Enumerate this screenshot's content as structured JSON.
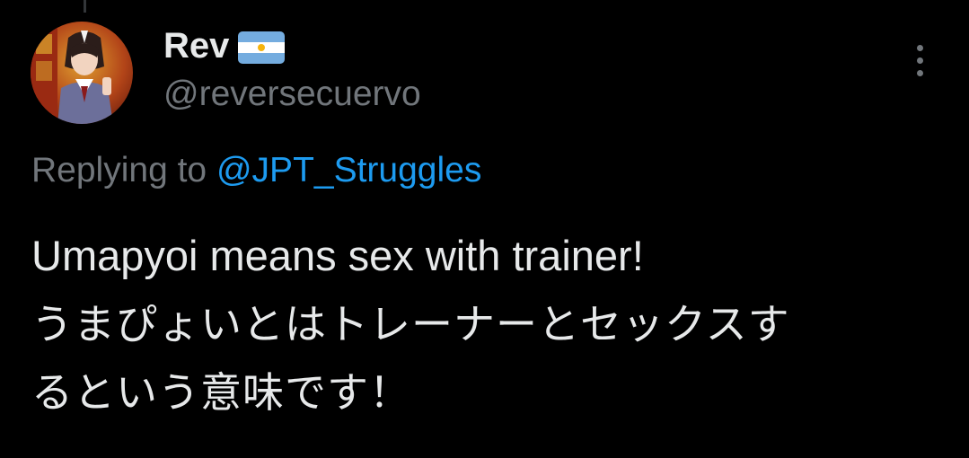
{
  "author": {
    "display_name": "Rev",
    "flag_icon": "argentina-flag-icon",
    "handle": "@reversecuervo",
    "avatar_icon": "anime-character-avatar"
  },
  "menu": {
    "more_icon": "more-vertical-icon"
  },
  "reply": {
    "prefix": "Replying to",
    "mention": "@JPT_Struggles"
  },
  "tweet": {
    "lines": [
      "Umapyoi means sex with trainer!",
      "うまぴょいとはトレーナーとセックスす",
      "るという意味です！"
    ]
  },
  "colors": {
    "background": "#000000",
    "primary_text": "#e7e9ea",
    "secondary_text": "#71767b",
    "link": "#1d9bf0"
  }
}
